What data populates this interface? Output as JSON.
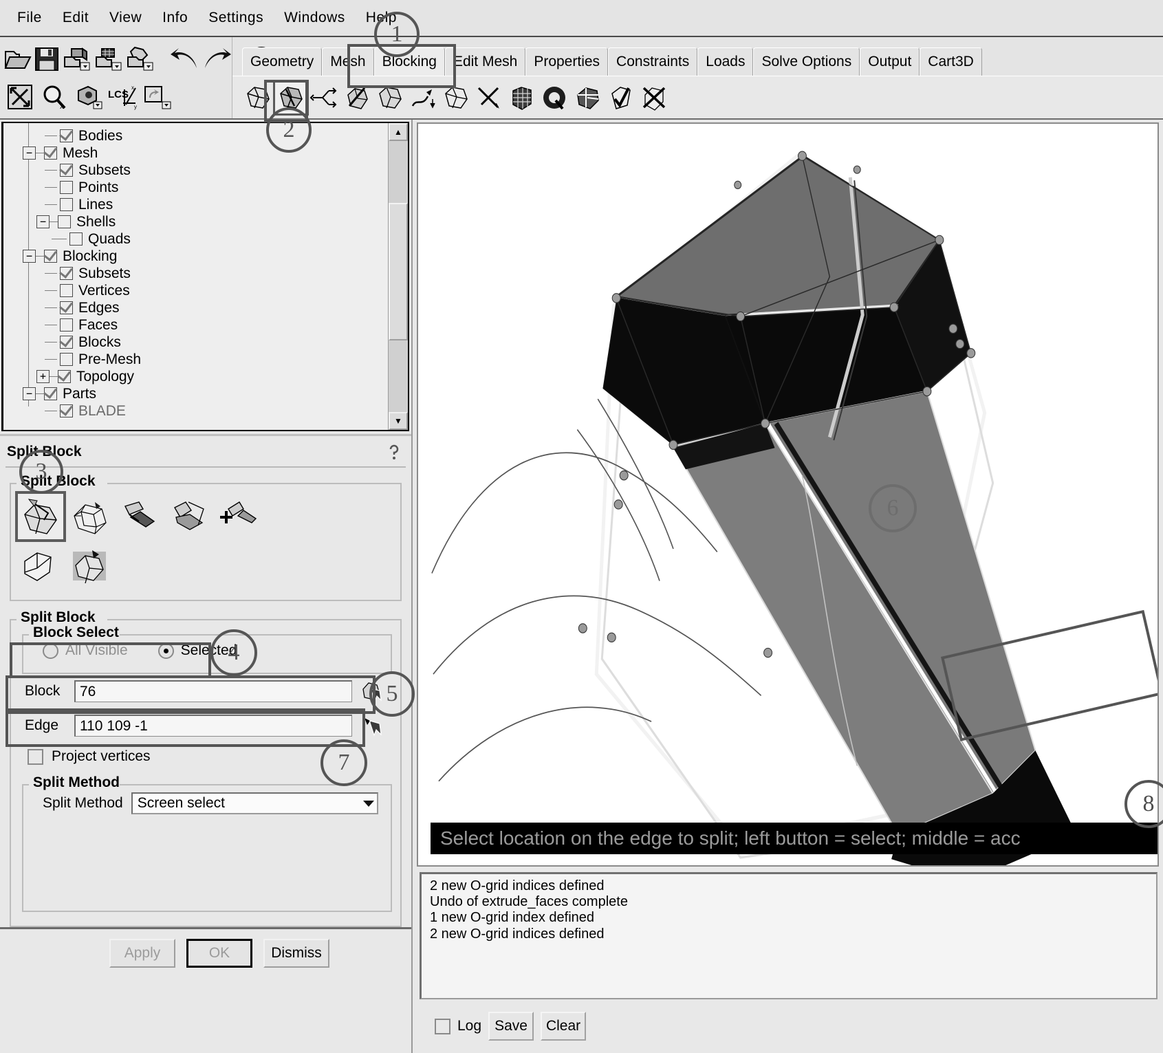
{
  "menu": {
    "items": [
      "File",
      "Edit",
      "View",
      "Info",
      "Settings",
      "Windows",
      "Help"
    ]
  },
  "toolbar": {
    "left_row1": [
      "open-folder-icon",
      "save-disk-icon",
      "save-geometry-icon",
      "save-mesh-icon",
      "save-blocking-icon"
    ],
    "left_row2": [
      "fit-view-icon",
      "zoom-box-icon",
      "rotate-view-icon",
      "lcs-axes-icon",
      "refresh-view-icon"
    ],
    "undo_label": "undo-arrow-icon",
    "redo_label": "redo-arrow-icon",
    "extra": [
      "split-sphere-icon",
      "solid-cylinder-icon"
    ]
  },
  "tabs": {
    "items": [
      "Geometry",
      "Mesh",
      "Blocking",
      "Edit Mesh",
      "Properties",
      "Constraints",
      "Loads",
      "Solve Options",
      "Output",
      "Cart3D"
    ],
    "active": "Blocking"
  },
  "blocking_toolbar": {
    "icons": [
      "create-block-icon",
      "split-block-icon",
      "merge-vertices-icon",
      "edit-block-icon",
      "associate-block-icon",
      "move-vertex-icon",
      "transform-block-icon",
      "edit-edge-icon",
      "premesh-params-icon",
      "ogrid-icon",
      "check-blocks-icon",
      "checkmark-icon",
      "delete-block-icon"
    ],
    "selected_index": 1
  },
  "tree": {
    "nodes": [
      {
        "label": "Bodies",
        "indent": 2,
        "checked": true,
        "expander": "none",
        "dim": false
      },
      {
        "label": "Mesh",
        "indent": 1,
        "checked": true,
        "expander": "minus",
        "dim": false
      },
      {
        "label": "Subsets",
        "indent": 2,
        "checked": true,
        "expander": "none",
        "dim": false
      },
      {
        "label": "Points",
        "indent": 2,
        "checked": false,
        "expander": "none",
        "dim": false
      },
      {
        "label": "Lines",
        "indent": 2,
        "checked": false,
        "expander": "none",
        "dim": false
      },
      {
        "label": "Shells",
        "indent": 2,
        "checked": false,
        "expander": "minus",
        "dim": false
      },
      {
        "label": "Quads",
        "indent": 3,
        "checked": false,
        "expander": "none",
        "dim": false
      },
      {
        "label": "Blocking",
        "indent": 1,
        "checked": true,
        "expander": "minus",
        "dim": false
      },
      {
        "label": "Subsets",
        "indent": 2,
        "checked": true,
        "expander": "none",
        "dim": false
      },
      {
        "label": "Vertices",
        "indent": 2,
        "checked": false,
        "expander": "none",
        "dim": false
      },
      {
        "label": "Edges",
        "indent": 2,
        "checked": true,
        "expander": "none",
        "dim": false
      },
      {
        "label": "Faces",
        "indent": 2,
        "checked": false,
        "expander": "none",
        "dim": false
      },
      {
        "label": "Blocks",
        "indent": 2,
        "checked": true,
        "expander": "none",
        "dim": false
      },
      {
        "label": "Pre-Mesh",
        "indent": 2,
        "checked": false,
        "expander": "none",
        "dim": false
      },
      {
        "label": "Topology",
        "indent": 2,
        "checked": true,
        "expander": "plus",
        "dim": false
      },
      {
        "label": "Parts",
        "indent": 1,
        "checked": true,
        "expander": "minus",
        "dim": false
      },
      {
        "label": "BLADE",
        "indent": 2,
        "checked": true,
        "expander": "none",
        "dim": true
      }
    ],
    "scroll_up_icon": "scroll-up-arrow-icon",
    "scroll_down_icon": "scroll-down-arrow-icon"
  },
  "panel": {
    "title": "Split Block",
    "help_icon": "help-question-icon",
    "method_group_legend": "Split Block",
    "method_icons": [
      "split-block-method-icon",
      "ogrid-block-method-icon",
      "split-face-method-icon",
      "extend-split-method-icon",
      "split-free-face-method-icon",
      "unsplit-block-method-icon",
      "split-vertices-method-icon"
    ],
    "method_selected_index": 0,
    "form_group_legend": "Split Block",
    "block_select": {
      "legend": "Block Select",
      "options": [
        "All Visible",
        "Selected"
      ],
      "selected": "Selected"
    },
    "block_field": {
      "label": "Block",
      "value": "76",
      "pick_icon": "select-block-cursor-icon"
    },
    "edge_field": {
      "label": "Edge",
      "value": "110 109 -1",
      "pick_icon": "select-edge-cursor-icon"
    },
    "project_vertices": {
      "label": "Project vertices",
      "checked": false
    },
    "split_method": {
      "legend": "Split Method",
      "label": "Split Method",
      "value": "Screen select",
      "dropdown_icon": "chevron-down-icon"
    },
    "buttons": {
      "apply": "Apply",
      "ok": "OK",
      "dismiss": "Dismiss"
    }
  },
  "viewport": {
    "status_text": "Select location on the edge to split; left button = select; middle = acc",
    "model_name": "blade-blocking-3d-model"
  },
  "messages": {
    "lines": [
      "2 new O-grid indices defined",
      "Undo of extrude_faces complete",
      "1 new O-grid index defined",
      "2 new O-grid indices defined"
    ],
    "log_checkbox": {
      "label": "Log",
      "checked": false
    },
    "save_button": "Save",
    "clear_button": "Clear"
  },
  "callouts": [
    {
      "n": "1"
    },
    {
      "n": "2"
    },
    {
      "n": "3"
    },
    {
      "n": "4"
    },
    {
      "n": "5"
    },
    {
      "n": "6"
    },
    {
      "n": "7"
    },
    {
      "n": "8"
    }
  ],
  "colors": {
    "panel_bg": "#e8e8e8",
    "highlight_border": "#555555",
    "status_bg": "#000000",
    "status_fg": "#9a9a9a"
  }
}
